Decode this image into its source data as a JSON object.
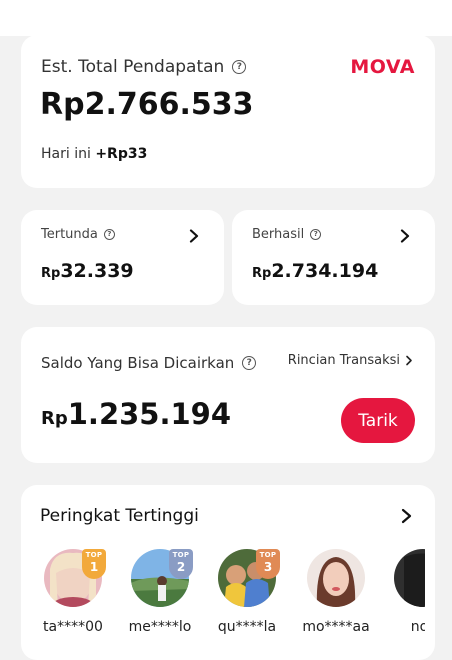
{
  "earnings": {
    "label": "Est. Total Pendapatan",
    "brand": "MOVA",
    "currency": "Rp",
    "amount": "2.766.533",
    "today_label": "Hari ini",
    "today_value": "+Rp33"
  },
  "pending": {
    "label": "Tertunda",
    "currency": "Rp",
    "amount": "32.339"
  },
  "success": {
    "label": "Berhasil",
    "currency": "Rp",
    "amount": "2.734.194"
  },
  "withdraw": {
    "label": "Saldo Yang Bisa Dicairkan",
    "detail_link": "Rincian Transaksi",
    "currency": "Rp",
    "amount": "1.235.194",
    "button": "Tarik"
  },
  "ranking": {
    "title": "Peringkat Tertinggi",
    "badge_text": "TOP",
    "items": [
      {
        "name": "ta****00",
        "rank": "1",
        "badge_color": "#f2a93b"
      },
      {
        "name": "me****lo",
        "rank": "2",
        "badge_color": "#8a9cc4"
      },
      {
        "name": "qu****la",
        "rank": "3",
        "badge_color": "#e08a55"
      },
      {
        "name": "mo****aa",
        "rank": "",
        "badge_color": ""
      },
      {
        "name": "no*",
        "rank": "",
        "badge_color": ""
      }
    ]
  },
  "icons": {
    "help": "question-circle-icon",
    "chevron": "chevron-right-icon"
  },
  "colors": {
    "accent": "#e5173f",
    "background": "#f2f2f2"
  }
}
